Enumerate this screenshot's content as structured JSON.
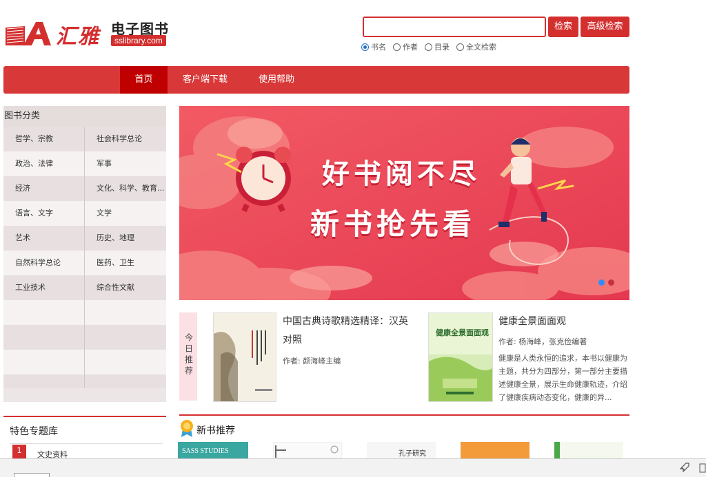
{
  "header": {
    "logo_brand": "汇雅",
    "logo_title": "电子图书",
    "logo_url": "sslibrary.com"
  },
  "search": {
    "value": "",
    "search_label": "检索",
    "advanced_label": "高级检索",
    "options": [
      {
        "label": "书名",
        "checked": true
      },
      {
        "label": "作者",
        "checked": false
      },
      {
        "label": "目录",
        "checked": false
      },
      {
        "label": "全文检索",
        "checked": false
      }
    ]
  },
  "nav": {
    "items": [
      {
        "label": "首页",
        "active": true
      },
      {
        "label": "客户端下载",
        "active": false
      },
      {
        "label": "使用帮助",
        "active": false
      }
    ]
  },
  "sidebar": {
    "title": "图书分类",
    "rows": [
      [
        "哲学、宗教",
        "社会科学总论"
      ],
      [
        "政治、法律",
        "军事"
      ],
      [
        "经济",
        "文化、科学、教育..."
      ],
      [
        "语言、文字",
        "文学"
      ],
      [
        "艺术",
        "历史、地理"
      ],
      [
        "自然科学总论",
        "医药、卫生"
      ],
      [
        "工业技术",
        "综合性文献"
      ],
      [
        "",
        ""
      ],
      [
        "",
        ""
      ],
      [
        "",
        ""
      ],
      [
        "",
        ""
      ]
    ]
  },
  "banner": {
    "line1": "好书阅不尽",
    "line2": "新书抢先看",
    "slide_count": 2,
    "active_slide": 1
  },
  "today": {
    "tag": "今日推荐",
    "books": [
      {
        "title": "中国古典诗歌精选精译：汉英对照",
        "author": "作者: 颜海峰主编"
      },
      {
        "title": "健康全景面面观",
        "author": "作者: 杨海峰，张克俭编著",
        "desc": "健康是人类永恒的追求，本书以健康为主题，共分为四部分，第一部分主要描述健康全景，展示生命健康轨迹，介绍了健康疾病动态变化，健康的异...",
        "cover_title": "健康全景面面观"
      }
    ]
  },
  "special": {
    "title": "特色专题库",
    "items": [
      {
        "num": "1",
        "label": "文史资料"
      }
    ]
  },
  "new_books": {
    "title": "新书推荐",
    "thumb_texts": [
      "SASS STUDIES",
      "孔子研究"
    ]
  },
  "colors": {
    "brand_red": "#d42f2f",
    "nav_red": "#d93838",
    "active_blue": "#2d8ef5"
  }
}
